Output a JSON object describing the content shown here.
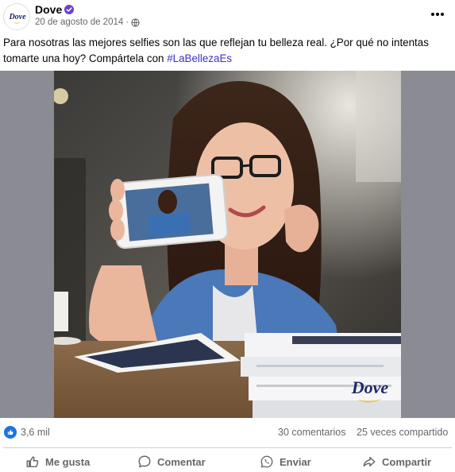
{
  "post": {
    "author": "Dove",
    "avatar_logo_text": "Dove",
    "date": "20 de agosto de 2014",
    "separator": "·",
    "caption_text": "Para nosotras las mejores selfies son las que reflejan tu belleza real. ¿Por qué no intentas tomarte una hoy? Compártela con ",
    "hashtag": "#LaBellezaEs",
    "image_logo_text": "Dove",
    "icons": [
      "verified-badge-icon",
      "globe-icon",
      "more-options-icon"
    ]
  },
  "stats": {
    "reactions_count": "3,6 mil",
    "comments": "30 comentarios",
    "shares": "25 veces compartido"
  },
  "actions": {
    "like": "Me gusta",
    "comment": "Comentar",
    "send": "Enviar",
    "share": "Compartir"
  },
  "colors": {
    "text": "#050505",
    "secondary_text": "#65676b",
    "hashtag": "#3b32c8",
    "reaction_blue": "#1b74e4",
    "verified": "#6b3fd4",
    "dove_navy": "#1f2a6b",
    "dove_gold": "#e8c547"
  }
}
